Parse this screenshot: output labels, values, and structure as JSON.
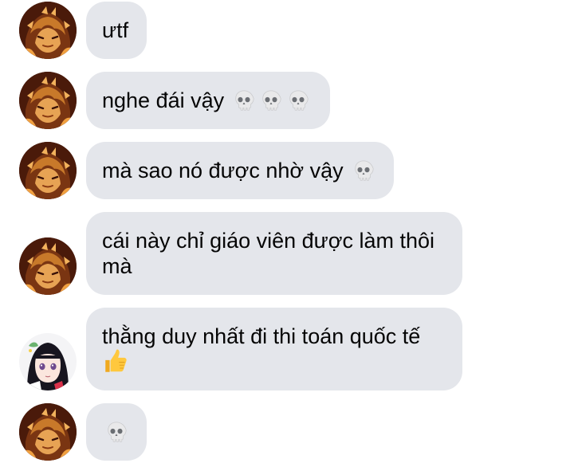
{
  "messages": [
    {
      "text": "ưtf",
      "sender": "user_a"
    },
    {
      "text": "nghe đái vậy",
      "sender": "user_a",
      "emojis": [
        "skull-icon",
        "skull-icon",
        "skull-icon"
      ]
    },
    {
      "text": "mà sao nó được nhờ vậy",
      "sender": "user_a",
      "emojis": [
        "skull-icon"
      ]
    },
    {
      "text_line1": "cái này chỉ giáo viên được làm thôi",
      "text_line2": "mà",
      "sender": "user_a"
    },
    {
      "text_line1": "thằng duy nhất đi thi toán quốc tế",
      "sender": "user_b",
      "emojis": [
        "thumbs-up-icon"
      ]
    },
    {
      "sender": "user_a",
      "emojis": [
        "skull-icon"
      ]
    }
  ],
  "colors": {
    "bubble_bg": "#e4e6eb",
    "text": "#050505",
    "skull": "#e9e9ea",
    "thumb": "#ffc83d"
  }
}
